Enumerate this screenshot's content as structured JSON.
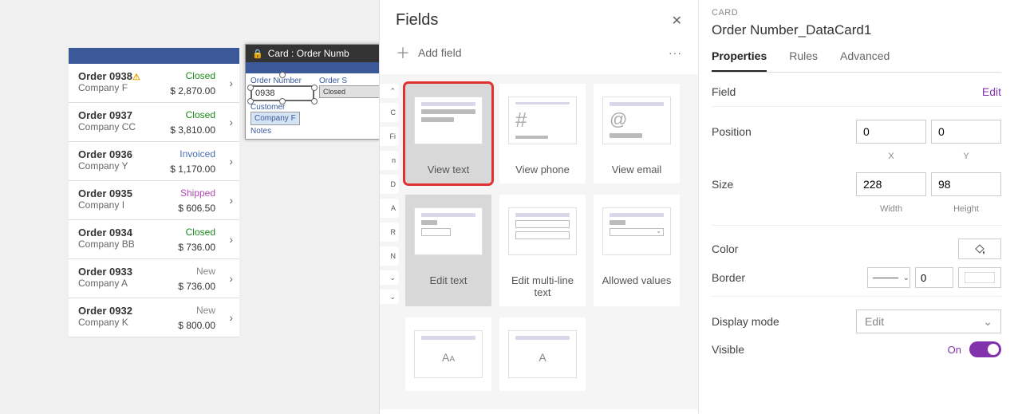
{
  "gallery": {
    "rows": [
      {
        "order": "Order 0938",
        "company": "Company F",
        "status": "Closed",
        "statusClass": "status-closed",
        "price": "$ 2,870.00",
        "warn": true
      },
      {
        "order": "Order 0937",
        "company": "Company CC",
        "status": "Closed",
        "statusClass": "status-closed",
        "price": "$ 3,810.00"
      },
      {
        "order": "Order 0936",
        "company": "Company Y",
        "status": "Invoiced",
        "statusClass": "status-invoiced",
        "price": "$ 1,170.00"
      },
      {
        "order": "Order 0935",
        "company": "Company I",
        "status": "Shipped",
        "statusClass": "status-shipped",
        "price": "$ 606.50"
      },
      {
        "order": "Order 0934",
        "company": "Company BB",
        "status": "Closed",
        "statusClass": "status-closed",
        "price": "$ 736.00"
      },
      {
        "order": "Order 0933",
        "company": "Company A",
        "status": "New",
        "statusClass": "status-new",
        "price": "$ 736.00"
      },
      {
        "order": "Order 0932",
        "company": "Company K",
        "status": "New",
        "statusClass": "status-new",
        "price": "$ 800.00"
      }
    ]
  },
  "form": {
    "header": "Card : Order Numb",
    "fields": {
      "orderNumber_label": "Order Number",
      "orderNumber_value": "0938",
      "orderStatus_label": "Order S",
      "orderStatus_value": "Closed",
      "customer_label": "Customer",
      "customer_value": "Company F",
      "notes_label": "Notes"
    }
  },
  "fieldsPanel": {
    "title": "Fields",
    "addField": "Add field",
    "partial": [
      "",
      "C",
      "Fi",
      "n",
      "D",
      "A",
      "R",
      "N"
    ],
    "tiles": [
      {
        "name": "view-text",
        "label": "View text",
        "kind": "text",
        "selected": true,
        "outline": true
      },
      {
        "name": "view-phone",
        "label": "View phone",
        "kind": "hash"
      },
      {
        "name": "view-email",
        "label": "View email",
        "kind": "at"
      },
      {
        "name": "edit-text",
        "label": "Edit text",
        "kind": "edit",
        "selected": true
      },
      {
        "name": "edit-multiline",
        "label": "Edit multi-line text",
        "kind": "multiline"
      },
      {
        "name": "allowed-values",
        "label": "Allowed values",
        "kind": "dropdown"
      }
    ]
  },
  "props": {
    "category": "CARD",
    "name": "Order Number_DataCard1",
    "tabs": {
      "properties": "Properties",
      "rules": "Rules",
      "advanced": "Advanced"
    },
    "field_label": "Field",
    "field_edit": "Edit",
    "position_label": "Position",
    "pos_x": "0",
    "pos_y": "0",
    "x_label": "X",
    "y_label": "Y",
    "size_label": "Size",
    "width": "228",
    "height": "98",
    "width_label": "Width",
    "height_label": "Height",
    "color_label": "Color",
    "border_label": "Border",
    "border_val": "0",
    "displaymode_label": "Display mode",
    "displaymode_value": "Edit",
    "visible_label": "Visible",
    "visible_value": "On"
  }
}
